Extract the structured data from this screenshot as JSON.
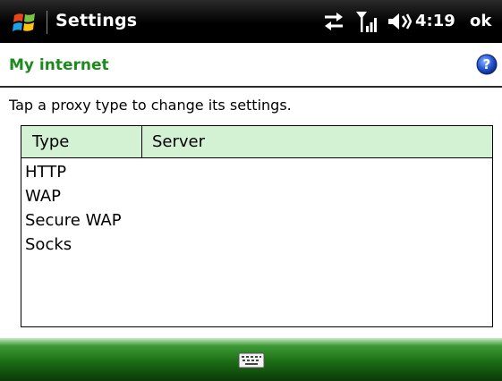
{
  "titlebar": {
    "app_title": "Settings",
    "clock": "4:19",
    "ok_label": "ok",
    "icons": [
      "windows-start-icon",
      "sync-icon",
      "signal-icon",
      "volume-icon"
    ]
  },
  "section": {
    "title": "My internet",
    "help_icon": "help-icon"
  },
  "instruction": "Tap a proxy type to change its settings.",
  "table": {
    "columns": [
      "Type",
      "Server"
    ],
    "rows": [
      "HTTP",
      "WAP",
      "Secure WAP",
      "Socks"
    ]
  },
  "softkeys": {
    "center_icon": "keyboard-icon"
  },
  "colors": {
    "titlebar_bg": "#000000",
    "section_title": "#1e8a1e",
    "header_bg": "#d3f2d3",
    "softkey_green": "#1b6d14"
  }
}
